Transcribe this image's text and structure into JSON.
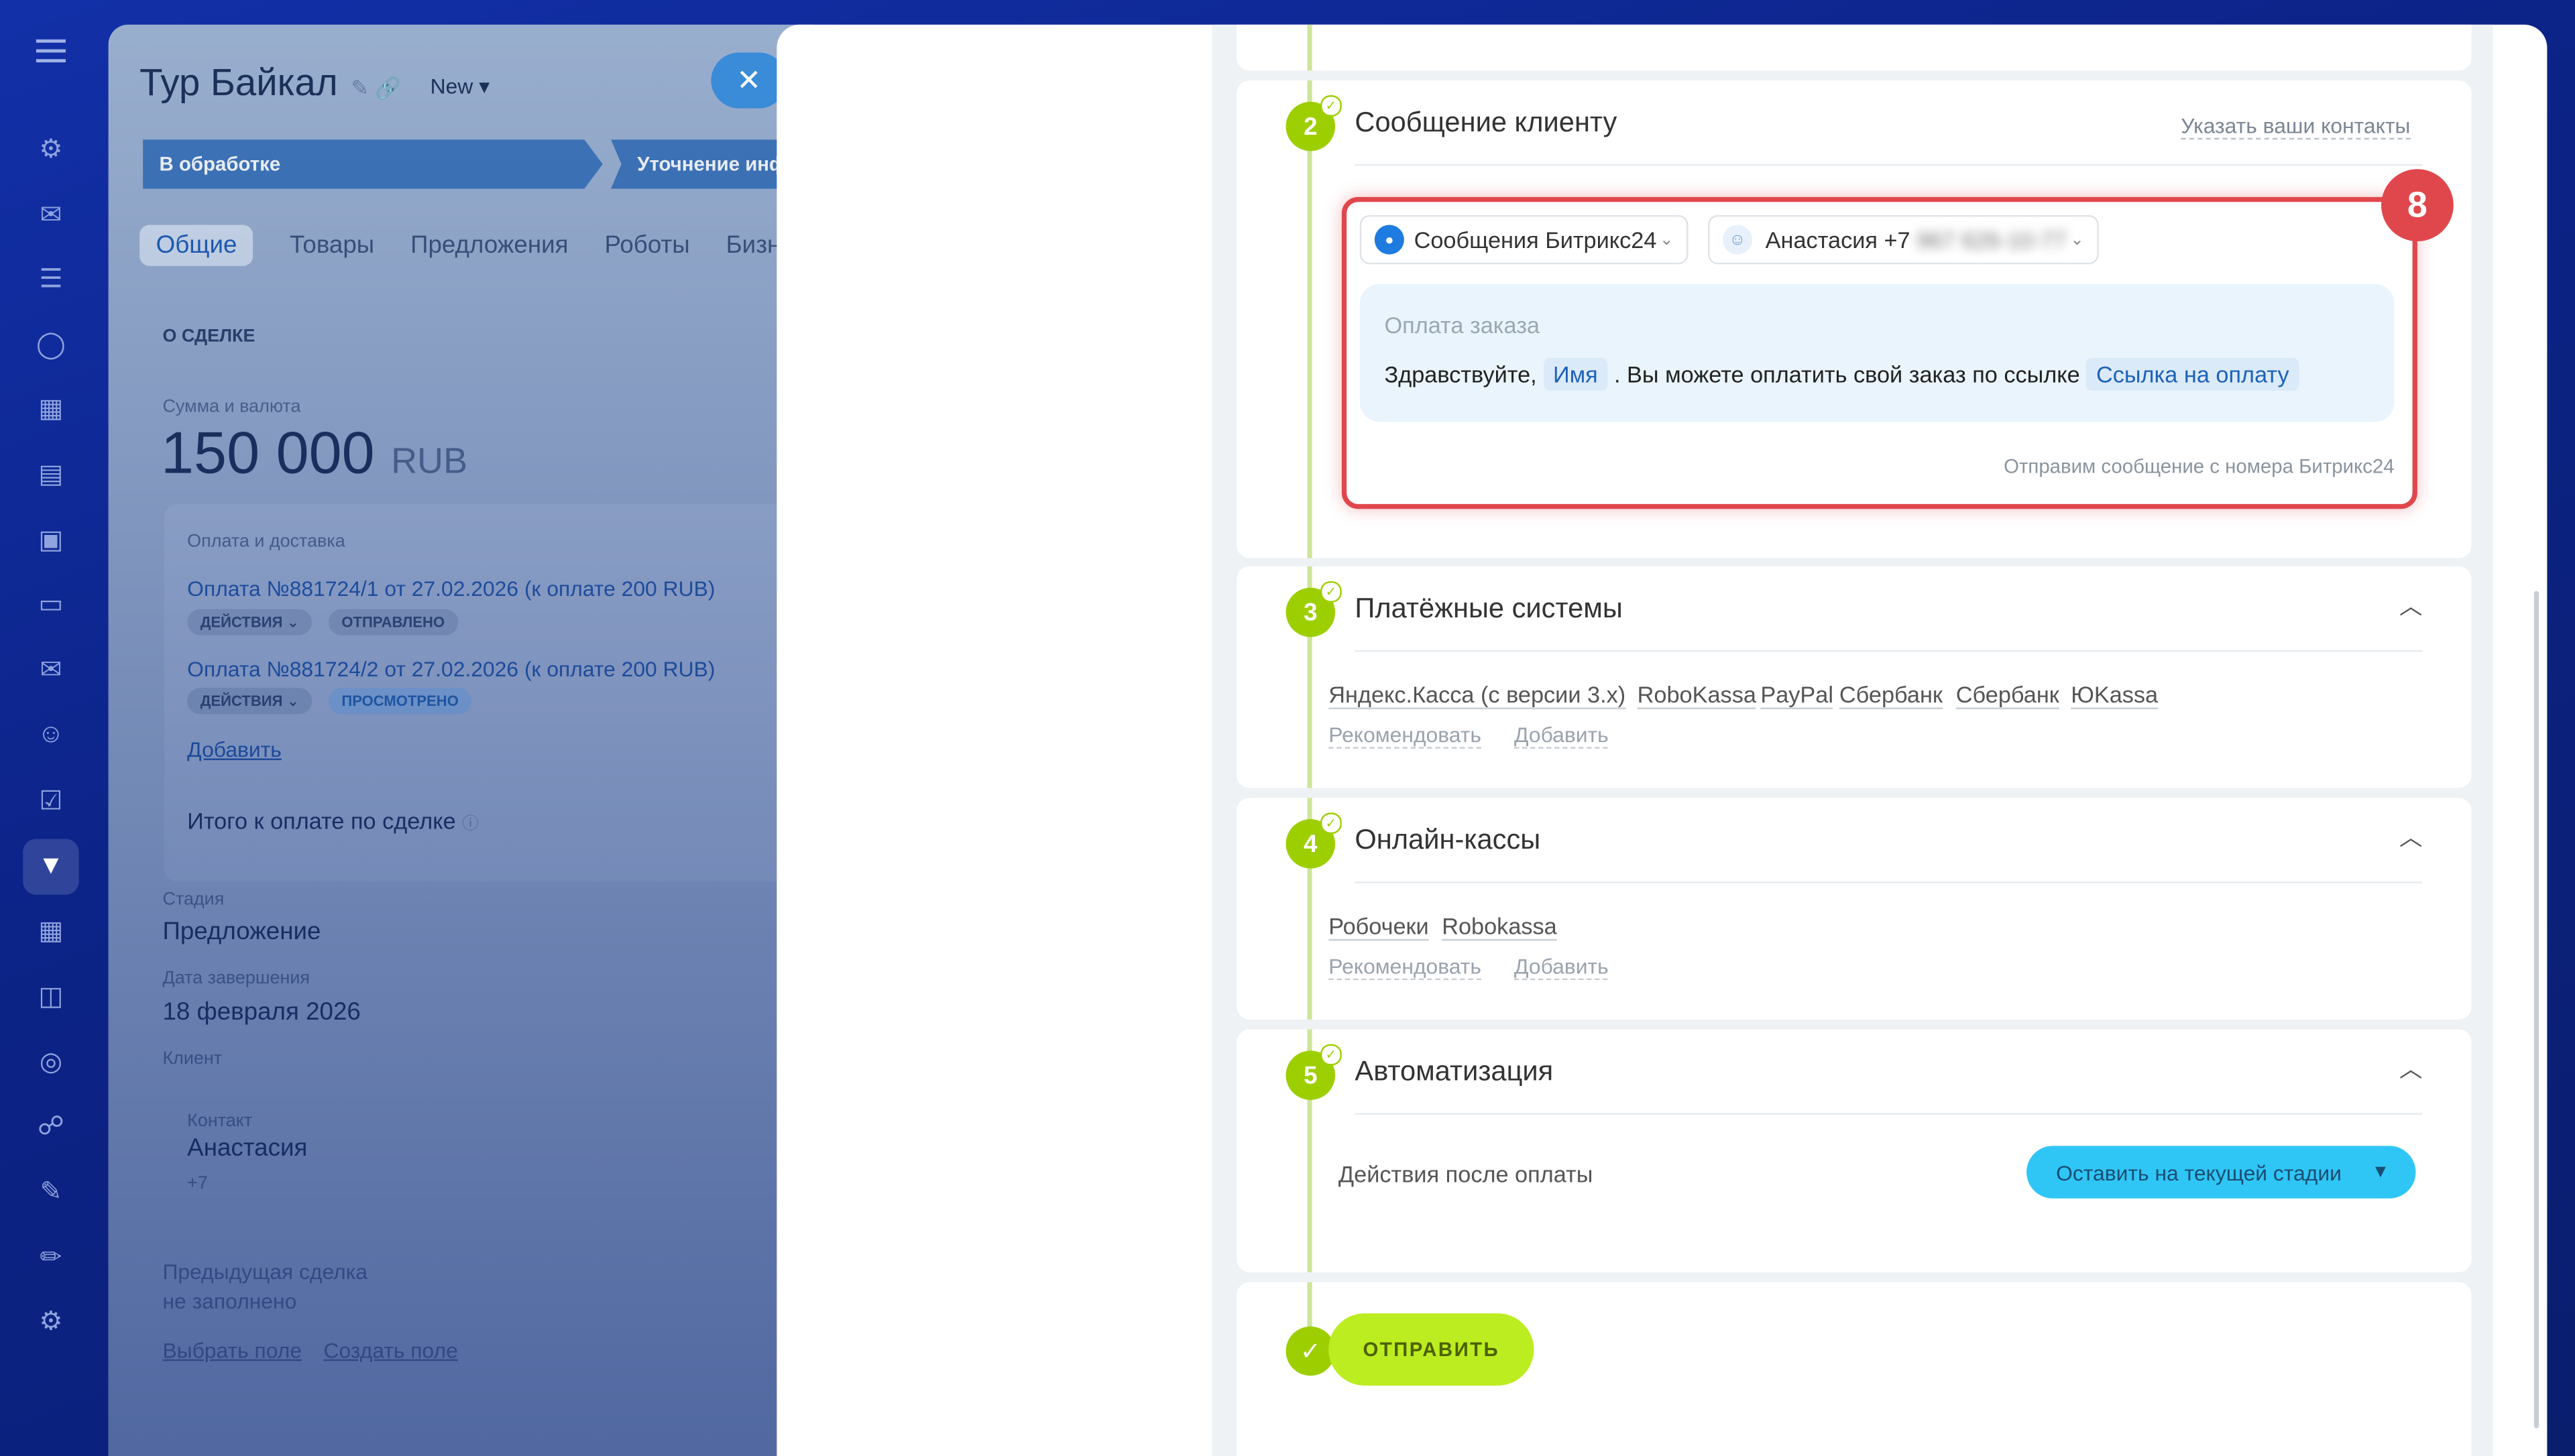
{
  "deal": {
    "title": "Тур Байкал",
    "stage_badge": "New",
    "stages": [
      "В обработке",
      "Уточнение инфо"
    ],
    "tabs": [
      "Общие",
      "Товары",
      "Предложения",
      "Роботы",
      "Бизнес"
    ],
    "section_title": "О СДЕЛКЕ",
    "amount_label": "Сумма и валюта",
    "amount_value": "150 000",
    "amount_currency": "RUB",
    "payments_label": "Оплата и доставка",
    "payments": [
      {
        "text": "Оплата №881724/1 от 27.02.2026 (к оплате 200 RUB)",
        "action": "ДЕЙСТВИЯ",
        "status": "ОТПРАВЛЕНО"
      },
      {
        "text": "Оплата №881724/2 от 27.02.2026 (к оплате 200 RUB)",
        "action": "ДЕЙСТВИЯ",
        "status": "ПРОСМОТРЕНО"
      }
    ],
    "add_link": "Добавить",
    "total_label": "Итого к оплате по сделке",
    "stage_label": "Стадия",
    "stage_value": "Предложение",
    "end_date_label": "Дата завершения",
    "end_date_value": "18 февраля 2026",
    "client_label": "Клиент",
    "contact_label": "Контакт",
    "contact_name": "Анастасия",
    "contact_phone": "+7",
    "prev_label": "Предыдущая сделка",
    "prev_value": "не заполнено",
    "field_select": "Выбрать поле",
    "field_create": "Создать поле"
  },
  "panel": {
    "step2": {
      "number": "2",
      "title": "Сообщение клиенту",
      "link": "Указать ваши контакты",
      "channel": "Сообщения Битрикс24",
      "recipient": "Анастасия +7",
      "phone_hidden": "967 626-10-77",
      "message_title": "Оплата заказа",
      "message_greeting": "Здравствуйте,",
      "message_var_name": "Имя",
      "message_body": ". Вы можете оплатить свой заказ по ссылке",
      "message_var_link": "Ссылка на оплату",
      "footer_note": "Отправим сообщение с номера Битрикс24",
      "highlight_badge": "8"
    },
    "step3": {
      "number": "3",
      "title": "Платёжные системы",
      "items": [
        "Яндекс.Касса (с версии 3.x)",
        "RoboKassa",
        "PayPal",
        "Сбербанк",
        "Сбербанк",
        "ЮKassa"
      ],
      "recommend": "Рекомендовать",
      "add": "Добавить"
    },
    "step4": {
      "number": "4",
      "title": "Онлайн-кассы",
      "items": [
        "Робочеки",
        "Robokassa"
      ],
      "recommend": "Рекомендовать",
      "add": "Добавить"
    },
    "step5": {
      "number": "5",
      "title": "Автоматизация",
      "after_payment_label": "Действия после оплаты",
      "after_payment_value": "Оставить на текущей стадии"
    },
    "send_button": "ОТПРАВИТЬ"
  },
  "colors": {
    "accent_green": "#9dcf00",
    "send_green": "#bbed21",
    "highlight_red": "#e0474c",
    "dropdown_blue": "#2fc6f6"
  }
}
